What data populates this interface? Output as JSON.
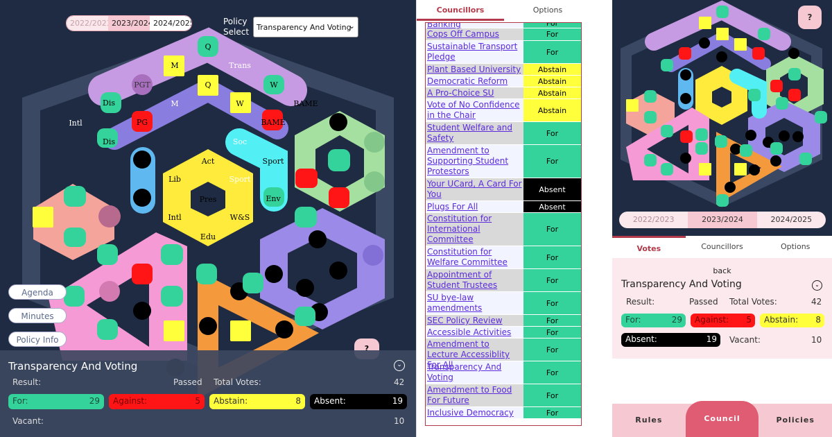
{
  "years": [
    "2022/2023",
    "2023/2024",
    "2024/2025"
  ],
  "policy_label": "Policy\nSelect",
  "policy_selected": "Transparency And Voting",
  "side_buttons": [
    "Agenda",
    "Minutes",
    "Policy Info"
  ],
  "seat_labels": {
    "outer": [
      "Q",
      "M",
      "Trans",
      "PGT",
      "W",
      "Dis",
      "M",
      "Q",
      "BAME",
      "Intl",
      "PG",
      "W",
      "BAME",
      "Dis"
    ],
    "inner": [
      "Act",
      "Soc",
      "Sport",
      "Lib",
      "Sport",
      "Pres",
      "Env",
      "Intl",
      "W&S",
      "Edu"
    ]
  },
  "summary": {
    "title": "Transparency And Voting",
    "result_label": "Result:",
    "result_value": "Passed",
    "total_label": "Total Votes:",
    "total_value": "42",
    "for_label": "For:",
    "for_value": "29",
    "against_label": "Against:",
    "against_value": "5",
    "abstain_label": "Abstain:",
    "abstain_value": "8",
    "absent_label": "Absent:",
    "absent_value": "19",
    "vacant_label": "Vacant:",
    "vacant_value": "10",
    "back": "back"
  },
  "middle_tabs": [
    "Councillors",
    "Options"
  ],
  "policies": [
    {
      "name": "Banking",
      "vote": "For"
    },
    {
      "name": "Cops Off Campus",
      "vote": "For"
    },
    {
      "name": "Sustainable Transport Pledge",
      "vote": "For"
    },
    {
      "name": "Plant Based University",
      "vote": "Abstain"
    },
    {
      "name": "Democratic Reform",
      "vote": "Abstain"
    },
    {
      "name": "A Pro-Choice SU",
      "vote": "Abstain"
    },
    {
      "name": "Vote of No Confidence in the Chair",
      "vote": "Abstain"
    },
    {
      "name": "Student Welfare and Safety",
      "vote": "For"
    },
    {
      "name": "Amendment to Supporting Student Protestors",
      "vote": "For"
    },
    {
      "name": "Your UCard, A Card For You",
      "vote": "Absent"
    },
    {
      "name": "Plugs For All",
      "vote": "Absent"
    },
    {
      "name": "Constitution for International Committee",
      "vote": "For"
    },
    {
      "name": "Constitution for Welfare Committee",
      "vote": "For"
    },
    {
      "name": "Appointment of Student Trustees",
      "vote": "For"
    },
    {
      "name": "SU bye-law amendments",
      "vote": "For"
    },
    {
      "name": "SEC Policy Review",
      "vote": "For"
    },
    {
      "name": "Accessible Activities",
      "vote": "For"
    },
    {
      "name": "Amendment to Lecture Accessiblity For All",
      "vote": "For"
    },
    {
      "name": "Transparency And Voting",
      "vote": "For"
    },
    {
      "name": "Amendment to Food For Future",
      "vote": "For"
    },
    {
      "name": "Inclusive Democracy",
      "vote": "For"
    }
  ],
  "right_tabs": [
    "Votes",
    "Councillors",
    "Options"
  ],
  "help_label": "?",
  "help_small": "?",
  "bottom_nav": [
    "Rules",
    "Council",
    "Policies"
  ],
  "colors": {
    "for": "#33d39b",
    "against": "#ff1515",
    "abstain": "#ffff3c",
    "absent": "#000000",
    "background": "#1f2b42",
    "accent": "#b23a4a"
  }
}
